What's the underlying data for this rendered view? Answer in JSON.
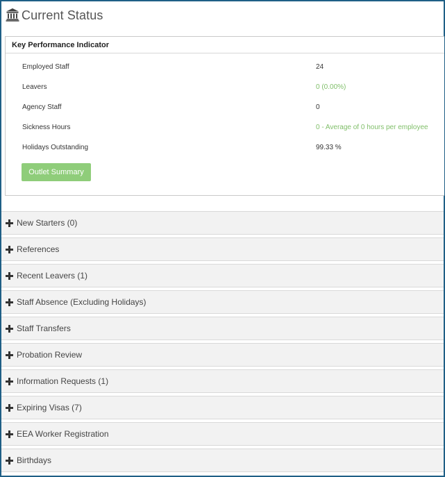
{
  "header": {
    "title": "Current Status",
    "icon": "bank-icon"
  },
  "kpi": {
    "heading": "Key Performance Indicator",
    "rows": [
      {
        "label": "Employed Staff",
        "value": "24",
        "highlight": false
      },
      {
        "label": "Leavers",
        "value": "0 (0.00%)",
        "highlight": true
      },
      {
        "label": "Agency Staff",
        "value": "0",
        "highlight": false
      },
      {
        "label": "Sickness Hours",
        "value": "0 - Average of 0 hours per employee",
        "highlight": true
      },
      {
        "label": "Holidays Outstanding",
        "value": "99.33 %",
        "highlight": false
      }
    ],
    "button_label": "Outlet Summary"
  },
  "sections": [
    {
      "label": "New Starters (0)"
    },
    {
      "label": "References"
    },
    {
      "label": "Recent Leavers (1)"
    },
    {
      "label": "Staff Absence (Excluding Holidays)"
    },
    {
      "label": "Staff Transfers"
    },
    {
      "label": "Probation Review"
    },
    {
      "label": "Information Requests (1)"
    },
    {
      "label": "Expiring Visas (7)"
    },
    {
      "label": "EEA Worker Registration"
    },
    {
      "label": "Birthdays"
    }
  ],
  "colors": {
    "border": "#1f5f86",
    "button": "#8fcd7a",
    "highlight_text": "#80bf6a",
    "section_bg": "#f2f2f2"
  }
}
